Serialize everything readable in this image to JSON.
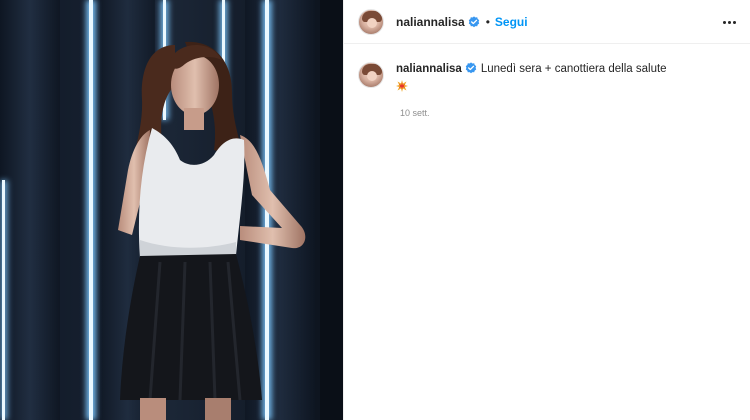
{
  "post": {
    "image_alt": "Photo"
  },
  "header": {
    "username": "naliannalisa",
    "separator": "•",
    "follow_label": "Segui",
    "more_icon": "more-horizontal-icon"
  },
  "caption": {
    "username": "naliannalisa",
    "text": "Lunedì sera + canottiera della salute",
    "emoji": "collision-emoji"
  },
  "timestamp": "10 sett.",
  "colors": {
    "accent": "#0095f6",
    "verified": "#3897f0",
    "muted": "#8e8e8e"
  }
}
